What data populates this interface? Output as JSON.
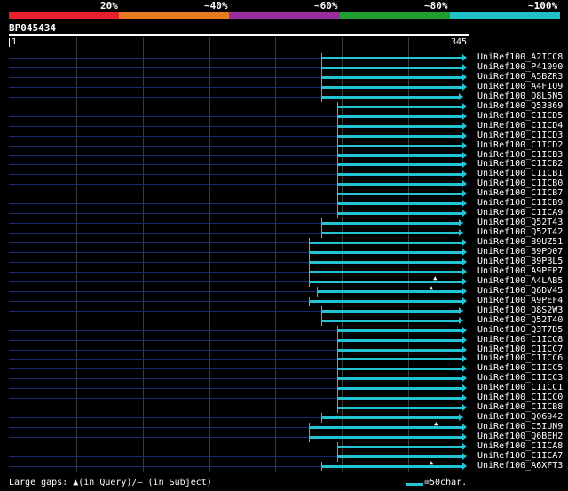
{
  "legend": {
    "labels": [
      "20%",
      "~40%",
      "~60%",
      "~80%",
      "~100%"
    ],
    "colors": [
      "#e8202e",
      "#e87a20",
      "#9a2ea0",
      "#20a030",
      "#20c0c8"
    ]
  },
  "title": "BP045434",
  "scale": {
    "start": "1",
    "end": "345"
  },
  "rows": [
    {
      "label": "UniRef100_A2ICC8",
      "start": 0.679,
      "end": 0.995,
      "arrow": true
    },
    {
      "label": "UniRef100_P41090",
      "start": 0.679,
      "end": 0.995,
      "arrow": true
    },
    {
      "label": "UniRef100_A5BZR3",
      "start": 0.679,
      "end": 0.995,
      "arrow": true
    },
    {
      "label": "UniRef100_A4F1Q9",
      "start": 0.679,
      "end": 0.995,
      "arrow": true
    },
    {
      "label": "UniRef100_Q8L5N5",
      "start": 0.679,
      "end": 0.986,
      "arrow": true
    },
    {
      "label": "UniRef100_Q53B69",
      "start": 0.713,
      "end": 0.995,
      "arrow": true
    },
    {
      "label": "UniRef100_C1ICD5",
      "start": 0.713,
      "end": 0.995,
      "arrow": true
    },
    {
      "label": "UniRef100_C1ICD4",
      "start": 0.713,
      "end": 0.995,
      "arrow": true
    },
    {
      "label": "UniRef100_C1ICD3",
      "start": 0.713,
      "end": 0.995,
      "arrow": true
    },
    {
      "label": "UniRef100_C1ICD2",
      "start": 0.713,
      "end": 0.995,
      "arrow": true
    },
    {
      "label": "UniRef100_C1ICB3",
      "start": 0.713,
      "end": 0.995,
      "arrow": true
    },
    {
      "label": "UniRef100_C1ICB2",
      "start": 0.713,
      "end": 0.995,
      "arrow": true
    },
    {
      "label": "UniRef100_C1ICB1",
      "start": 0.713,
      "end": 0.995,
      "arrow": true
    },
    {
      "label": "UniRef100_C1ICB0",
      "start": 0.713,
      "end": 0.995,
      "arrow": true
    },
    {
      "label": "UniRef100_C1ICB7",
      "start": 0.713,
      "end": 0.995,
      "arrow": true
    },
    {
      "label": "UniRef100_C1ICB9",
      "start": 0.713,
      "end": 0.995,
      "arrow": true
    },
    {
      "label": "UniRef100_C1ICA9",
      "start": 0.713,
      "end": 0.995,
      "arrow": true
    },
    {
      "label": "UniRef100_Q52T43",
      "start": 0.679,
      "end": 0.986,
      "arrow": true
    },
    {
      "label": "UniRef100_Q52T42",
      "start": 0.679,
      "end": 0.986,
      "arrow": true
    },
    {
      "label": "UniRef100_B9UZ51",
      "start": 0.652,
      "end": 0.995,
      "arrow": true
    },
    {
      "label": "UniRef100_B9PD07",
      "start": 0.652,
      "end": 0.995,
      "arrow": true
    },
    {
      "label": "UniRef100_B9PBL5",
      "start": 0.652,
      "end": 0.995,
      "arrow": true
    },
    {
      "label": "UniRef100_A9PEP7",
      "start": 0.652,
      "end": 0.995,
      "arrow": true
    },
    {
      "label": "UniRef100_A4LAB5",
      "start": 0.652,
      "end": 0.995,
      "arrow": true,
      "gap": 0.925
    },
    {
      "label": "UniRef100_Q6DV45",
      "start": 0.668,
      "end": 0.995,
      "arrow": true,
      "gap": 0.917
    },
    {
      "label": "UniRef100_A9PEF4",
      "start": 0.652,
      "end": 0.995,
      "arrow": true
    },
    {
      "label": "UniRef100_Q8S2W3",
      "start": 0.679,
      "end": 0.986,
      "arrow": true
    },
    {
      "label": "UniRef100_Q52T40",
      "start": 0.679,
      "end": 0.986,
      "arrow": true
    },
    {
      "label": "UniRef100_Q3T7D5",
      "start": 0.713,
      "end": 0.995,
      "arrow": true
    },
    {
      "label": "UniRef100_C1ICC8",
      "start": 0.713,
      "end": 0.995,
      "arrow": true
    },
    {
      "label": "UniRef100_C1ICC7",
      "start": 0.713,
      "end": 0.995,
      "arrow": true
    },
    {
      "label": "UniRef100_C1ICC6",
      "start": 0.713,
      "end": 0.995,
      "arrow": true
    },
    {
      "label": "UniRef100_C1ICC5",
      "start": 0.713,
      "end": 0.995,
      "arrow": true
    },
    {
      "label": "UniRef100_C1ICC3",
      "start": 0.713,
      "end": 0.995,
      "arrow": true
    },
    {
      "label": "UniRef100_C1ICC1",
      "start": 0.713,
      "end": 0.995,
      "arrow": true
    },
    {
      "label": "UniRef100_C1ICC0",
      "start": 0.713,
      "end": 0.995,
      "arrow": true
    },
    {
      "label": "UniRef100_C1ICB8",
      "start": 0.713,
      "end": 0.995,
      "arrow": true
    },
    {
      "label": "UniRef100_Q06942",
      "start": 0.679,
      "end": 0.986,
      "arrow": true
    },
    {
      "label": "UniRef100_C5IUN9",
      "start": 0.652,
      "end": 0.995,
      "arrow": true,
      "gap": 0.927
    },
    {
      "label": "UniRef100_Q6BEH2",
      "start": 0.652,
      "end": 0.995,
      "arrow": true
    },
    {
      "label": "UniRef100_C1ICA8",
      "start": 0.713,
      "end": 0.995,
      "arrow": true
    },
    {
      "label": "UniRef100_C1ICA7",
      "start": 0.713,
      "end": 0.995,
      "arrow": true
    },
    {
      "label": "UniRef100_A6XFT3",
      "start": 0.679,
      "end": 0.995,
      "arrow": true,
      "gap": 0.917
    }
  ],
  "footer": {
    "gaps_text": "Large gaps: ▲(in Query)/– (in Subject)",
    "scale_text": "=50char."
  },
  "colors": {
    "hit": "#22c4d4",
    "background": "#000000"
  }
}
